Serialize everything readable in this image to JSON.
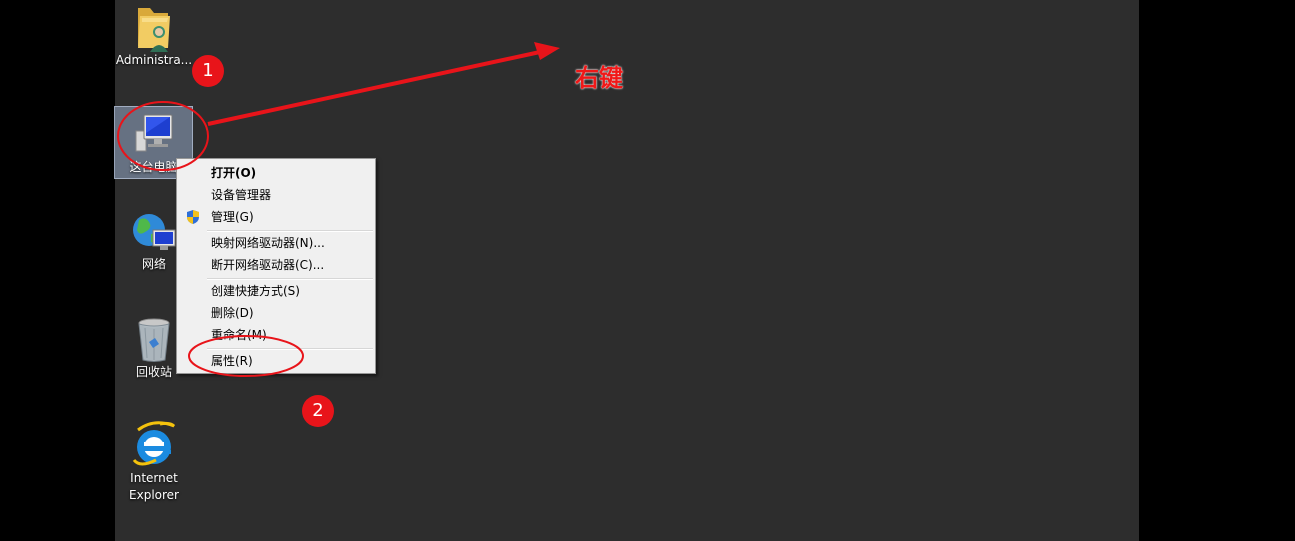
{
  "desktop": {
    "background_color": "#2d2d2d",
    "icons": [
      {
        "label": "Administra...",
        "icon": "user-folder-icon"
      },
      {
        "label": "这台电脑",
        "icon": "computer-icon"
      },
      {
        "label": "网络",
        "icon": "network-icon"
      },
      {
        "label": "回收站",
        "icon": "recycle-bin-icon"
      },
      {
        "label": "Internet Explorer",
        "icon": "internet-explorer-icon"
      }
    ]
  },
  "context_menu": {
    "items": [
      {
        "label": "打开(O)",
        "bold": true
      },
      {
        "label": "设备管理器"
      },
      {
        "label": "管理(G)",
        "icon": "uac-shield-icon"
      },
      {
        "label": "映射网络驱动器(N)..."
      },
      {
        "label": "断开网络驱动器(C)..."
      },
      {
        "label": "创建快捷方式(S)"
      },
      {
        "label": "删除(D)"
      },
      {
        "label": "重命名(M)"
      },
      {
        "label": "属性(R)"
      }
    ]
  },
  "annotations": {
    "step1": "1",
    "step2": "2",
    "arrow_text": "右键",
    "color": "#e8141a"
  }
}
